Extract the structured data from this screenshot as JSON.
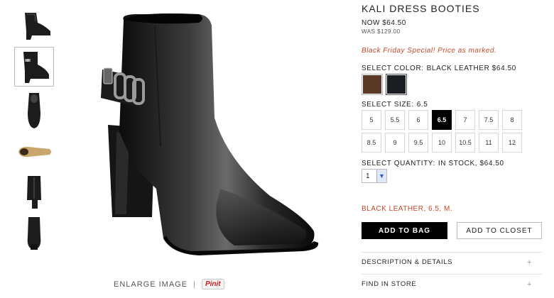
{
  "product": {
    "title": "KALI DRESS BOOTIES",
    "price_now": "NOW $64.50",
    "price_was": "WAS $129.00",
    "promo": "Black Friday Special! Price as marked."
  },
  "color": {
    "label": "SELECT COLOR:",
    "value": "BLACK LEATHER $64.50",
    "swatches": [
      {
        "name": "brown leather",
        "hex": "#5a3a26"
      },
      {
        "name": "black leather",
        "hex": "#1a1d22"
      }
    ],
    "selected_index": 1
  },
  "size": {
    "label": "SELECT SIZE:",
    "value": "6.5",
    "options": [
      "5",
      "5.5",
      "6",
      "6.5",
      "7",
      "7.5",
      "8",
      "8.5",
      "9",
      "9.5",
      "10",
      "10.5",
      "11",
      "12"
    ],
    "selected": "6.5"
  },
  "quantity": {
    "label": "SELECT QUANTITY:",
    "value": "IN STOCK, $64.50",
    "selected": "1"
  },
  "selection_summary": "BLACK LEATHER, 6.5, M.",
  "buttons": {
    "add_to_bag": "ADD TO BAG",
    "add_to_closet": "ADD TO CLOSET"
  },
  "accordion": [
    {
      "label": "DESCRIPTION & DETAILS",
      "icon": "+"
    },
    {
      "label": "FIND IN STORE",
      "icon": "+"
    }
  ],
  "gallery": {
    "enlarge_label": "ENLARGE IMAGE",
    "separator": "|",
    "pinit_label": "Pinit",
    "thumbnails": [
      "side-view",
      "side-view-buckle",
      "top-view",
      "sole-view",
      "back-view",
      "front-view"
    ],
    "selected_thumbnail": 1
  },
  "colors": {
    "accent_red": "#c0492b",
    "black": "#000000"
  }
}
